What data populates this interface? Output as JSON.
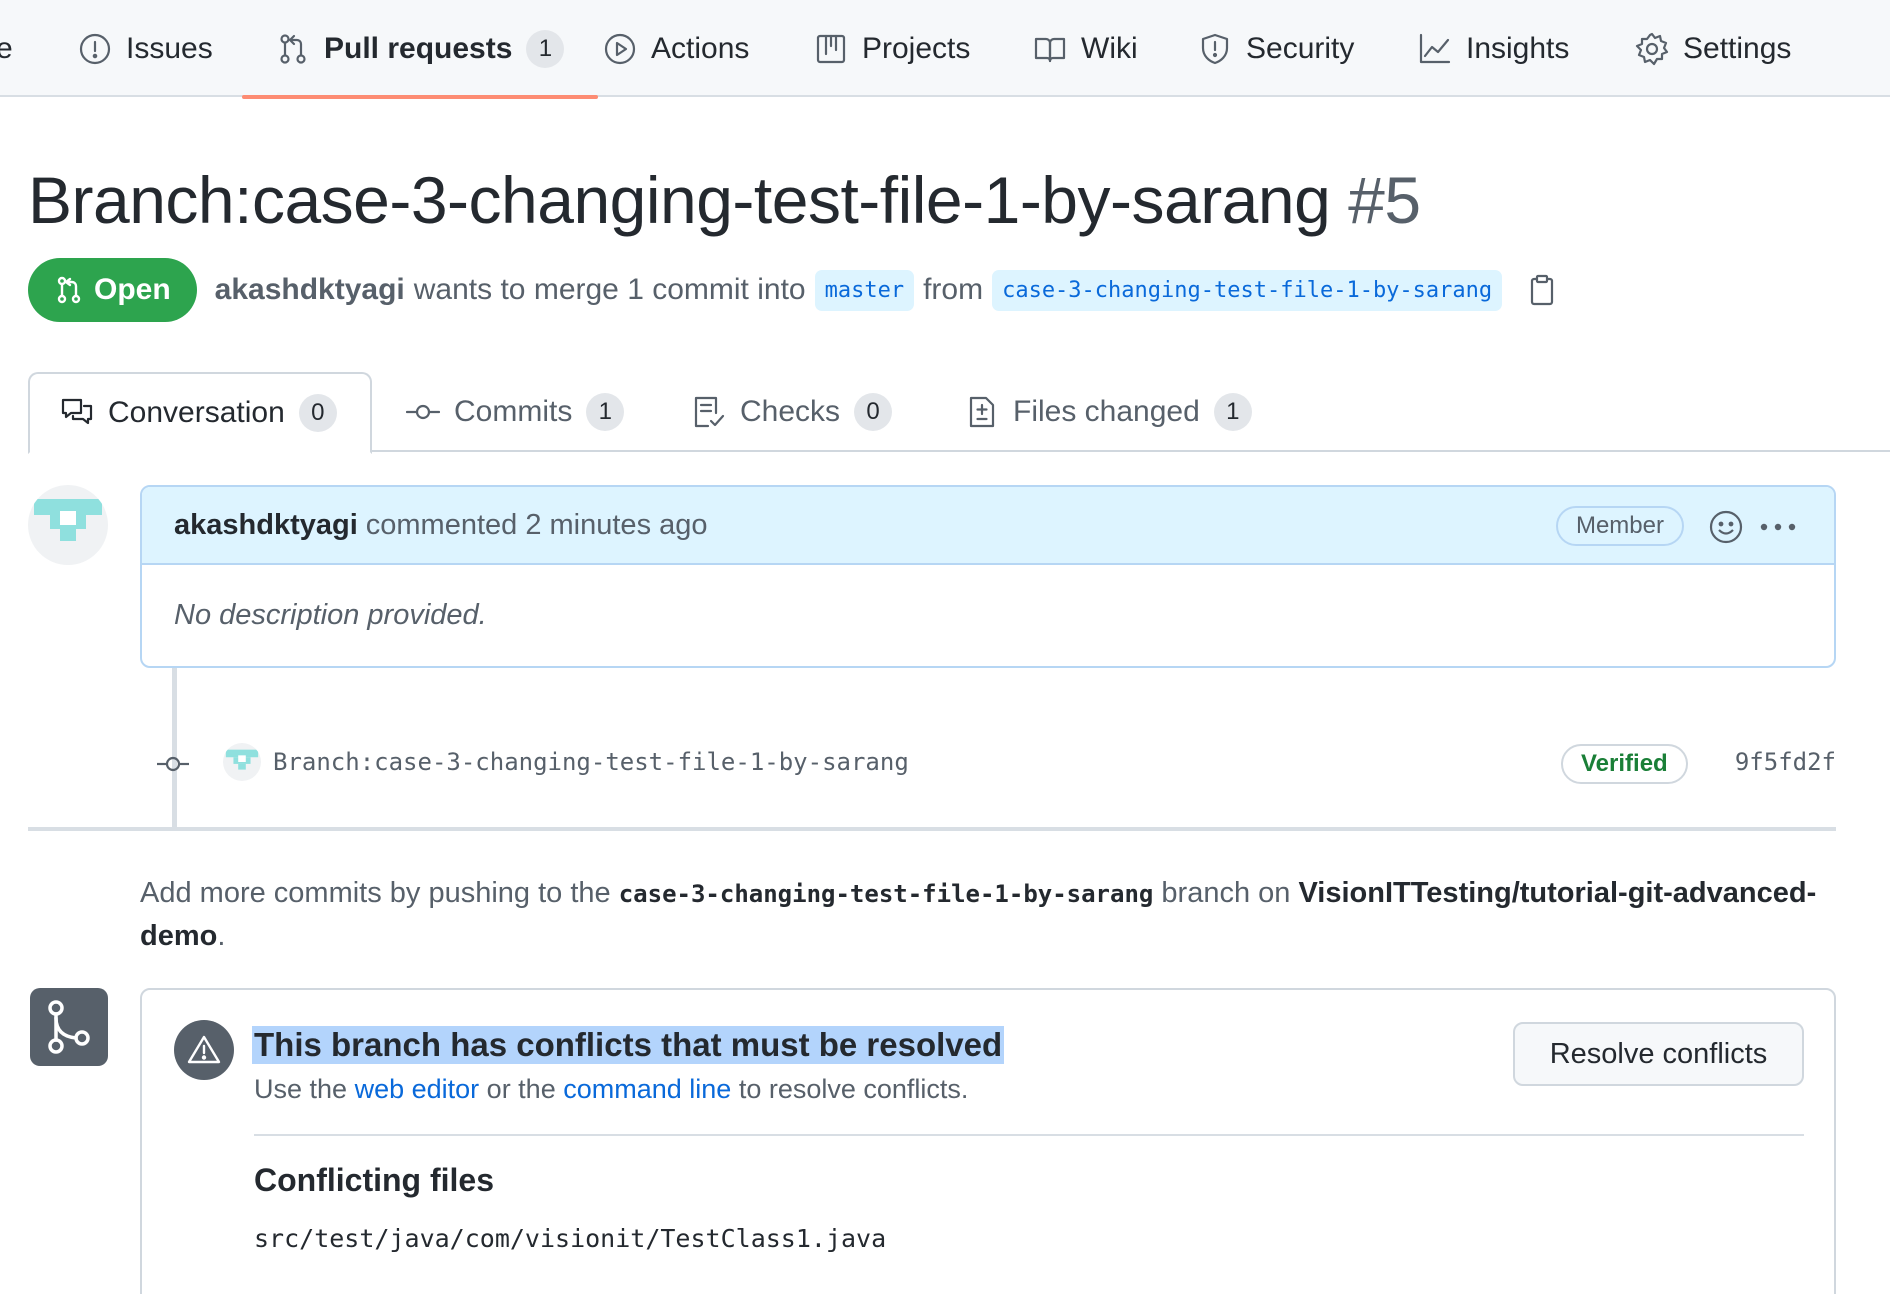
{
  "repo_nav": {
    "partial_label": "e",
    "items": [
      {
        "label": "Issues",
        "icon": "issue-opened-icon"
      },
      {
        "label": "Pull requests",
        "icon": "git-pull-request-icon",
        "count": "1",
        "active": true
      },
      {
        "label": "Actions",
        "icon": "play-icon"
      },
      {
        "label": "Projects",
        "icon": "table-icon"
      },
      {
        "label": "Wiki",
        "icon": "book-icon"
      },
      {
        "label": "Security",
        "icon": "shield-icon"
      },
      {
        "label": "Insights",
        "icon": "graph-icon"
      },
      {
        "label": "Settings",
        "icon": "gear-icon"
      }
    ]
  },
  "pr": {
    "title": "Branch:case-3-changing-test-file-1-by-sarang",
    "number": "#5",
    "state": "Open",
    "author": "akashdktyagi",
    "merge_text": "wants to merge 1 commit into",
    "base_branch": "master",
    "from_text": "from",
    "head_branch": "case-3-changing-test-file-1-by-sarang"
  },
  "tabs": [
    {
      "label": "Conversation",
      "count": "0",
      "icon": "comment-discussion-icon",
      "selected": true
    },
    {
      "label": "Commits",
      "count": "1",
      "icon": "git-commit-icon"
    },
    {
      "label": "Checks",
      "count": "0",
      "icon": "checklist-icon"
    },
    {
      "label": "Files changed",
      "count": "1",
      "icon": "file-diff-icon"
    }
  ],
  "comment": {
    "author": "akashdktyagi",
    "action": "commented 2 minutes ago",
    "role_badge": "Member",
    "body": "No description provided."
  },
  "commit": {
    "message": "Branch:case-3-changing-test-file-1-by-sarang",
    "verified": "Verified",
    "sha": "9f5fd2f"
  },
  "push_hint": {
    "prefix": "Add more commits by pushing to the",
    "branch": "case-3-changing-test-file-1-by-sarang",
    "middle": "branch on",
    "repo": "VisionITTesting/tutorial-git-advanced-demo",
    "suffix": "."
  },
  "merge": {
    "title": "This branch has conflicts that must be resolved",
    "sub_prefix": "Use the",
    "web_editor_link": "web editor",
    "sub_middle": "or the",
    "command_line_link": "command line",
    "sub_suffix": "to resolve conflicts.",
    "resolve_button": "Resolve conflicts",
    "conflicting_files_label": "Conflicting files",
    "files": [
      "src/test/java/com/visionit/TestClass1.java"
    ]
  },
  "colors": {
    "open_green": "#2da44e",
    "nav_underline": "#fd8c73",
    "link_blue": "#0969da",
    "selection_highlight": "#b3d4fc",
    "verified_green": "#1a7f37"
  }
}
